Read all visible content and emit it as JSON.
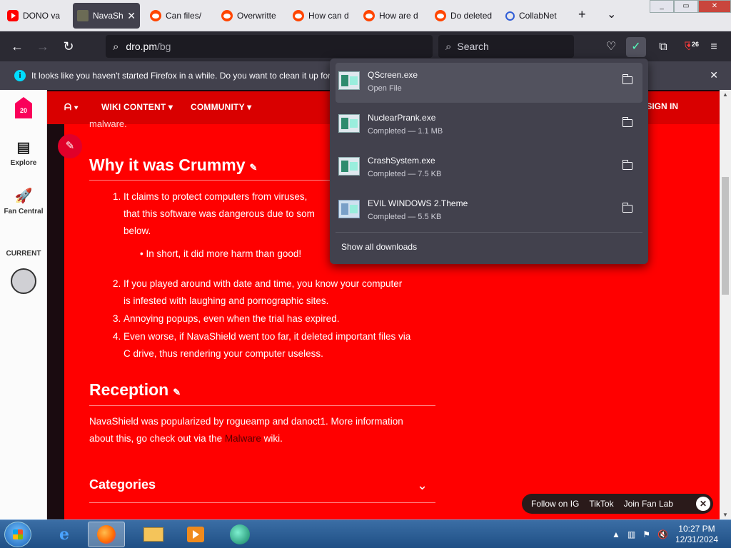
{
  "tabs": [
    {
      "label": "DONO va",
      "icon": "youtube-icon",
      "active": false
    },
    {
      "label": "NavaShi",
      "icon": "navashield-icon",
      "active": true
    },
    {
      "label": "Can files/",
      "icon": "reddit-icon",
      "active": false
    },
    {
      "label": "Overwritte",
      "icon": "reddit-icon",
      "active": false
    },
    {
      "label": "How can d",
      "icon": "reddit-icon",
      "active": false
    },
    {
      "label": "How are d",
      "icon": "reddit-icon",
      "active": false
    },
    {
      "label": "Do deleted",
      "icon": "reddit-icon",
      "active": false
    },
    {
      "label": "CollabNet",
      "icon": "search-icon",
      "active": false
    }
  ],
  "tabstrip": {
    "new_tab": "+",
    "list_tabs": "⌄",
    "close_glyph": "✕"
  },
  "window_controls": {
    "minimize": "_",
    "maximize": "▭",
    "close": "✕"
  },
  "navbar": {
    "url_domain": "dro.pm",
    "url_path": "/bg",
    "search_placeholder": "Search",
    "extension_badge": "26"
  },
  "notification": {
    "text": "It looks like you haven't started Firefox in a while. Do you want to clean it up for",
    "info_glyph": "i",
    "close_glyph": "✕"
  },
  "downloads": {
    "items": [
      {
        "name": "QScreen.exe",
        "status": "Open File"
      },
      {
        "name": "NuclearPrank.exe",
        "status": "Completed — 1.1 MB"
      },
      {
        "name": "CrashSystem.exe",
        "status": "Completed — 7.5 KB"
      },
      {
        "name": "EVIL WINDOWS 2.Theme",
        "status": "Completed — 5.5 KB"
      }
    ],
    "show_all": "Show all downloads"
  },
  "rail": {
    "logo_text": "20",
    "explore": "Explore",
    "fan_central": "Fan Central",
    "current": "CURRENT"
  },
  "wikinav": {
    "fandom_menu": "ᗩ",
    "wiki_content": "WIKI CONTENT",
    "community": "COMMUNITY",
    "sign_in": "SIGN IN"
  },
  "article": {
    "fragment": "malware.",
    "heading_1": "Why it was Crummy",
    "item_1_line1": "It claims to protect computers from viruses,",
    "item_1_line2": "that this software was dangerous due to som",
    "item_1_line3": "below.",
    "sub_bullet": "In short, it did more harm than good!",
    "item_2_line1": "If you played around with date and time, you know your computer",
    "item_2_line2": "is infested with laughing and pornographic sites.",
    "item_3": "Annoying popups, even when the trial has expired.",
    "item_4_line1": "Even worse, if NavaShield went too far, it deleted important files via",
    "item_4_line2": "C drive, thus rendering your computer useless.",
    "heading_2": "Reception",
    "reception_line1": "NavaShield was popularized by rogueamp and danoct1. More information",
    "reception_line2_pre": "about this, go check out via the",
    "reception_link": "Malware",
    "reception_line2_post": "wiki.",
    "heading_3": "Categories",
    "num_1": "1.",
    "num_2": "2.",
    "num_3": "3.",
    "num_4": "4."
  },
  "fan_pill": {
    "follow": "Follow on IG",
    "tiktok": "TikTok",
    "join": "Join Fan Lab",
    "close_glyph": "✕"
  },
  "taskbar": {
    "time": "10:27 PM",
    "date": "12/31/2024",
    "tray_arrow": "▲"
  },
  "colors": {
    "accent_red": "#ff0000",
    "nav_red": "#d90000",
    "firefox_panel": "#42414d"
  }
}
